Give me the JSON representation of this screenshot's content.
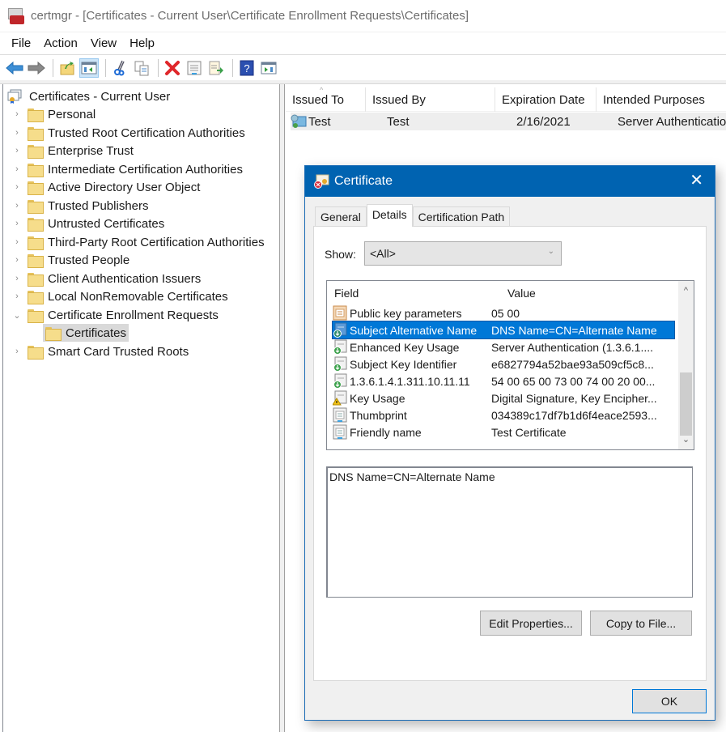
{
  "window": {
    "title": "certmgr - [Certificates - Current User\\Certificate Enrollment Requests\\Certificates]"
  },
  "menu": [
    "File",
    "Action",
    "View",
    "Help"
  ],
  "toolbar": {
    "buttons": [
      {
        "icon": "back-arrow-icon"
      },
      {
        "icon": "forward-arrow-icon"
      },
      {
        "icon": "up-folder-icon"
      },
      {
        "icon": "show-hide-console-tree-icon",
        "active": true
      },
      {
        "icon": "cut-icon"
      },
      {
        "icon": "copy-icon"
      },
      {
        "icon": "delete-icon"
      },
      {
        "icon": "properties-icon"
      },
      {
        "icon": "export-list-icon"
      },
      {
        "icon": "help-icon"
      },
      {
        "icon": "show-action-pane-icon"
      }
    ]
  },
  "tree": {
    "root": "Certificates - Current User",
    "items": [
      {
        "label": "Personal",
        "expanded": false
      },
      {
        "label": "Trusted Root Certification Authorities",
        "expanded": false
      },
      {
        "label": "Enterprise Trust",
        "expanded": false
      },
      {
        "label": "Intermediate Certification Authorities",
        "expanded": false
      },
      {
        "label": "Active Directory User Object",
        "expanded": false
      },
      {
        "label": "Trusted Publishers",
        "expanded": false
      },
      {
        "label": "Untrusted Certificates",
        "expanded": false
      },
      {
        "label": "Third-Party Root Certification Authorities",
        "expanded": false
      },
      {
        "label": "Trusted People",
        "expanded": false
      },
      {
        "label": "Client Authentication Issuers",
        "expanded": false
      },
      {
        "label": "Local NonRemovable Certificates",
        "expanded": false
      },
      {
        "label": "Certificate Enrollment Requests",
        "expanded": true
      },
      {
        "label": "Certificates",
        "child": true,
        "selected": true
      },
      {
        "label": "Smart Card Trusted Roots",
        "expanded": false
      }
    ]
  },
  "list": {
    "columns": [
      "Issued To",
      "Issued By",
      "Expiration Date",
      "Intended Purposes"
    ],
    "rows": [
      {
        "issued_to": "Test",
        "issued_by": "Test",
        "expiration": "2/16/2021",
        "purposes": "Server Authentication"
      }
    ]
  },
  "dialog": {
    "title": "Certificate",
    "tabs": [
      "General",
      "Details",
      "Certification Path"
    ],
    "active_tab": "Details",
    "show_label": "Show:",
    "show_value": "<All>",
    "field_header": "Field",
    "value_header": "Value",
    "fields": [
      {
        "field": "Public key parameters",
        "value": "05 00",
        "icon": "property-icon"
      },
      {
        "field": "Subject Alternative Name",
        "value": "DNS Name=CN=Alternate Name",
        "icon": "extension-icon",
        "selected": true
      },
      {
        "field": "Enhanced Key Usage",
        "value": "Server Authentication (1.3.6.1....",
        "icon": "extension-icon"
      },
      {
        "field": "Subject Key Identifier",
        "value": "e6827794a52bae93a509cf5c8...",
        "icon": "extension-icon"
      },
      {
        "field": "1.3.6.1.4.1.311.10.11.11",
        "value": "54 00 65 00 73 00 74 00 20 00...",
        "icon": "extension-icon"
      },
      {
        "field": "Key Usage",
        "value": "Digital Signature, Key Encipher...",
        "icon": "critical-extension-icon"
      },
      {
        "field": "Thumbprint",
        "value": "034389c17df7b1d6f4eace2593...",
        "icon": "property-icon"
      },
      {
        "field": "Friendly name",
        "value": "Test Certificate",
        "icon": "property-icon"
      }
    ],
    "detail_text": "DNS Name=CN=Alternate Name",
    "edit_properties": "Edit Properties...",
    "copy_to_file": "Copy to File...",
    "ok": "OK",
    "close_glyph": "✕"
  }
}
